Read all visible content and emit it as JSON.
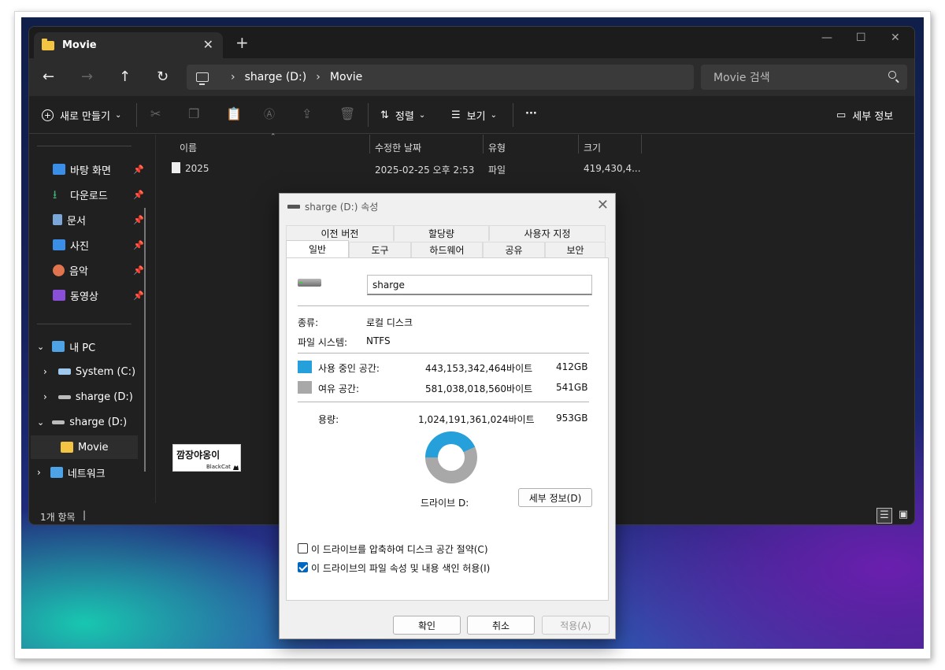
{
  "explorer": {
    "tab_title": "Movie",
    "address": {
      "segments": [
        "sharge (D:)",
        "Movie"
      ]
    },
    "search_placeholder": "Movie 검색",
    "toolbar": {
      "new_label": "새로 만들기",
      "sort_label": "정렬",
      "view_label": "보기",
      "more_label": "···",
      "details_label": "세부 정보"
    },
    "sidebar": {
      "quick_access": [
        {
          "label": "바탕 화면",
          "icon": "desktop-icon",
          "color": "#3b8ee8"
        },
        {
          "label": "다운로드",
          "icon": "download-icon",
          "color": "#3fb07a"
        },
        {
          "label": "문서",
          "icon": "document-icon",
          "color": "#7aa7d8"
        },
        {
          "label": "사진",
          "icon": "pictures-icon",
          "color": "#3b8ee8"
        },
        {
          "label": "음악",
          "icon": "music-icon",
          "color": "#e0744f"
        },
        {
          "label": "동영상",
          "icon": "videos-icon",
          "color": "#8a4fd8"
        }
      ],
      "this_pc": "내 PC",
      "system_c": "System (C:)",
      "sharge_d_child": "sharge (D:)",
      "sharge_d": "sharge (D:)",
      "movie": "Movie",
      "network": "네트워크"
    },
    "columns": [
      "이름",
      "수정한 날짜",
      "유형",
      "크기"
    ],
    "files": [
      {
        "name": "2025",
        "modified": "2025-02-25 오후 2:53",
        "type": "파일",
        "size": "419,430,4..."
      }
    ],
    "status": "1개 항목"
  },
  "dialog": {
    "title": "sharge (D:) 속성",
    "tabs_row1": [
      "이전 버전",
      "할당량",
      "사용자 지정"
    ],
    "tabs_row2": [
      "일반",
      "도구",
      "하드웨어",
      "공유",
      "보안"
    ],
    "drive_name_value": "sharge",
    "type_label": "종류:",
    "type_value": "로컬 디스크",
    "fs_label": "파일 시스템:",
    "fs_value": "NTFS",
    "used_label": "사용 중인 공간:",
    "used_bytes": "443,153,342,464바이트",
    "used_gb": "412GB",
    "free_label": "여유 공간:",
    "free_bytes": "581,038,018,560바이트",
    "free_gb": "541GB",
    "capacity_label": "용량:",
    "capacity_bytes": "1,024,191,361,024바이트",
    "capacity_gb": "953GB",
    "used_fraction": 0.433,
    "used_color": "#26a0da",
    "free_color": "#a8a8a8",
    "drive_label": "드라이브 D:",
    "details_button": "세부 정보(D)",
    "compress_label": "이 드라이브를 압축하여 디스크 공간 절약(C)",
    "compress_checked": false,
    "index_label": "이 드라이브의 파일 속성 및 내용 색인 허용(I)",
    "index_checked": true,
    "ok": "확인",
    "cancel": "취소",
    "apply": "적용(A)"
  },
  "watermark": {
    "line1": "깜장야옹이",
    "line2": "BlackCat"
  }
}
